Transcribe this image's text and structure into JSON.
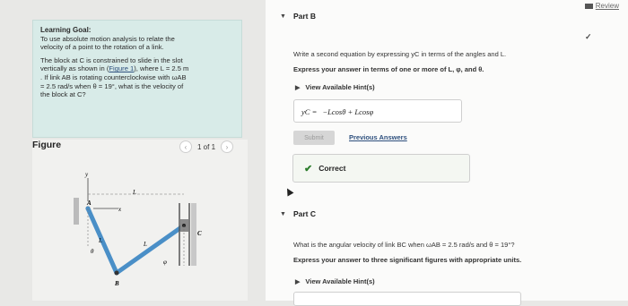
{
  "left": {
    "goal_title": "Learning Goal:",
    "goal_line1": "To use absolute motion analysis to relate the",
    "goal_line2": "velocity of a point to the rotation of a link.",
    "prob_line1": "The block at C is constrained to slide in the slot",
    "prob_line2a": "vertically as shown in (",
    "prob_link": "Figure 1",
    "prob_line2b": "), where L = 2.5 m",
    "prob_line3": ". If link AB is rotating counterclockwise with ωAB",
    "prob_line4": "= 2.5 rad/s when θ = 19°, what is the velocity of",
    "prob_line5": "the block at C?",
    "figure_label": "Figure",
    "pager_text": "1 of 1",
    "fig_labels": {
      "y": "y",
      "x": "x",
      "A": "A",
      "B": "B",
      "C": "C",
      "L_top": "L",
      "L_left": "L",
      "L_mid": "L",
      "theta": "θ",
      "phi": "φ"
    }
  },
  "right": {
    "review_label": "Review",
    "partB_title": "Part B",
    "partB_instruction": "Write a second equation by expressing yC in terms of the angles and L.",
    "partB_express": "Express your answer in terms of one or more of L, φ, and θ.",
    "view_hints": "View Available Hint(s)",
    "answer_lhs": "yC =",
    "answer_rhs": "−Lcosθ + Lcosφ",
    "submit_label": "Submit",
    "previous_answers": "Previous Answers",
    "correct_label": "Correct",
    "partC_title": "Part C",
    "partC_question": "What is the angular velocity of link BC when ωAB = 2.5 rad/s and θ = 19°?",
    "partC_express": "Express your answer to three significant figures with appropriate units."
  }
}
